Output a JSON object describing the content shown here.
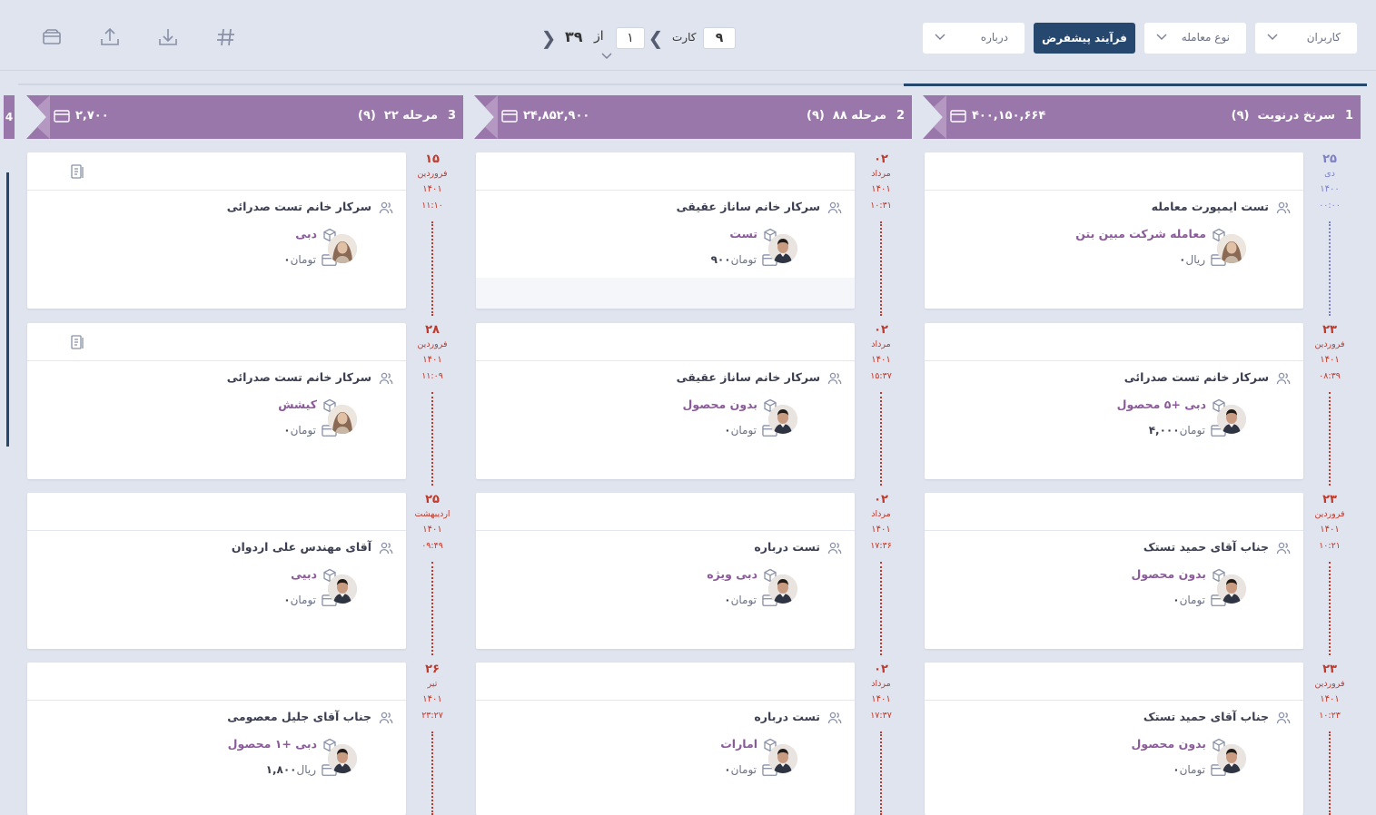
{
  "toolbar": {
    "filters": {
      "users": "کاربران",
      "deal_type": "نوع معامله",
      "about": "درباره",
      "default_process": "فرآیند پیشفرض"
    },
    "pager": {
      "per_page": "۹",
      "card_label": "کارت",
      "current_page": "۱",
      "of_label": "از",
      "total_pages": "۳۹"
    },
    "icons": [
      "hash-icon",
      "download-icon",
      "upload-icon",
      "inbox-icon"
    ]
  },
  "stages": [
    {
      "num": "1",
      "name": "سرنخ درنوبت",
      "count": "(۹)",
      "amount": "۴۰۰,۱۵۰,۶۶۴"
    },
    {
      "num": "2",
      "name": "مرحله ۸۸",
      "count": "(۹)",
      "amount": "۲۴,۸۵۲,۹۰۰"
    },
    {
      "num": "3",
      "name": "مرحله ۲۲",
      "count": "(۹)",
      "amount": "۲,۷۰۰"
    },
    {
      "num": "4"
    }
  ],
  "columns": [
    {
      "cards": [
        {
          "person": "تست ایمپورت معامله",
          "product": "معامله شرکت مبین بتن",
          "amount": "۰",
          "currency": "ریال",
          "avatar": "female",
          "date": {
            "day": "۲۵",
            "month": "دی",
            "year": "۱۴۰۰",
            "time": "۰۰:۰۰"
          }
        },
        {
          "person": "سرکار خانم تست صدرائی",
          "product": "دبی  +۵ محصول",
          "amount": "۴,۰۰۰",
          "currency": "تومان",
          "avatar": "male",
          "date": {
            "day": "۲۳",
            "month": "فروردین",
            "year": "۱۴۰۱",
            "time": "۰۸:۳۹"
          }
        },
        {
          "person": "جناب آقای حمید تستک",
          "product": "بدون محصول",
          "amount": "۰",
          "currency": "تومان",
          "avatar": "male",
          "date": {
            "day": "۲۳",
            "month": "فروردین",
            "year": "۱۴۰۱",
            "time": "۱۰:۲۱"
          }
        },
        {
          "person": "جناب آقای حمید تستک",
          "product": "بدون محصول",
          "amount": "۰",
          "currency": "تومان",
          "avatar": "male",
          "date": {
            "day": "۲۳",
            "month": "فروردین",
            "year": "۱۴۰۱",
            "time": "۱۰:۲۳"
          }
        }
      ]
    },
    {
      "cards": [
        {
          "person": "سرکار خانم ساناز عقیقی",
          "product": "تست",
          "amount": "۹۰۰",
          "currency": "تومان",
          "avatar": "male",
          "date": {
            "day": "۰۲",
            "month": "مرداد",
            "year": "۱۴۰۱",
            "time": "۱۰:۳۱"
          }
        },
        {
          "person": "سرکار خانم ساناز عقیقی",
          "product": "بدون محصول",
          "amount": "۰",
          "currency": "تومان",
          "avatar": "male",
          "date": {
            "day": "۰۲",
            "month": "مرداد",
            "year": "۱۴۰۱",
            "time": "۱۵:۳۷"
          }
        },
        {
          "person": "تست درباره",
          "product": "دبی ویژه",
          "amount": "۰",
          "currency": "تومان",
          "avatar": "male",
          "date": {
            "day": "۰۲",
            "month": "مرداد",
            "year": "۱۴۰۱",
            "time": "۱۷:۳۶"
          }
        },
        {
          "person": "تست درباره",
          "product": "امارات",
          "amount": "۰",
          "currency": "تومان",
          "avatar": "male",
          "date": {
            "day": "۰۲",
            "month": "مرداد",
            "year": "۱۴۰۱",
            "time": "۱۷:۳۷"
          }
        }
      ]
    },
    {
      "cards": [
        {
          "person": "سرکار خانم تست صدرائی",
          "product": "دبی",
          "amount": "۰",
          "currency": "تومان",
          "avatar": "female",
          "date": {
            "day": "۱۵",
            "month": "فروردین",
            "year": "۱۴۰۱",
            "time": "۱۱:۱۰"
          }
        },
        {
          "person": "سرکار خانم تست صدرائی",
          "product": "کیشش",
          "amount": "۰",
          "currency": "تومان",
          "avatar": "female",
          "date": {
            "day": "۲۸",
            "month": "فروردین",
            "year": "۱۴۰۱",
            "time": "۱۱:۰۹"
          }
        },
        {
          "person": "آقای مهندس علی اردوان",
          "product": "دبیی",
          "amount": "۰",
          "currency": "تومان",
          "avatar": "male",
          "date": {
            "day": "۲۵",
            "month": "اردیبهشت",
            "year": "۱۴۰۱",
            "time": "۰۹:۴۹"
          }
        },
        {
          "person": "جناب آقای جلیل معصومی",
          "product": "دبی  +۱ محصول",
          "amount": "۱,۸۰۰",
          "currency": "ریال",
          "avatar": "male",
          "date": {
            "day": "۲۶",
            "month": "تیر",
            "year": "۱۴۰۱",
            "time": "۲۳:۲۷"
          }
        }
      ]
    }
  ]
}
